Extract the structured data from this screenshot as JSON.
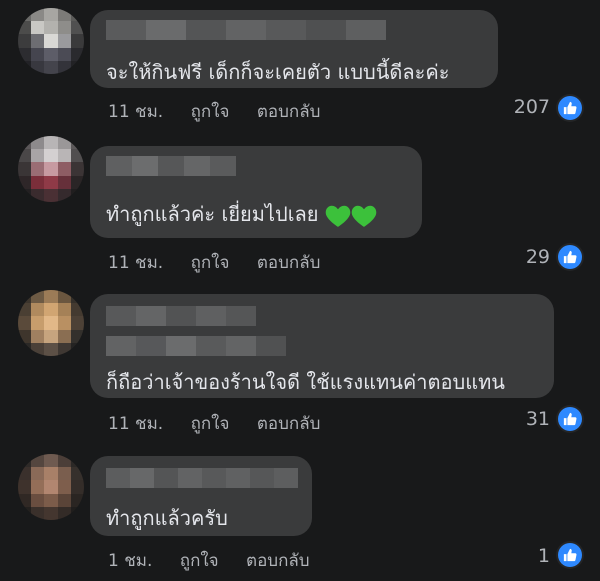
{
  "comments": [
    {
      "text": "จะให้กินฟรี เด็กก็จะเคยตัว แบบนี้ดีละค่ะ",
      "time": "11 ชม.",
      "like": "ถูกใจ",
      "reply": "ตอบกลับ",
      "reactions": "207"
    },
    {
      "text": "ทำถูกแล้วค่ะ เยี่ยมไปเลย",
      "emoji": "green-heart-icon",
      "time": "11 ชม.",
      "like": "ถูกใจ",
      "reply": "ตอบกลับ",
      "reactions": "29"
    },
    {
      "text": "ก็ถือว่าเจ้าของร้านใจดี ใช้แรงแทนค่าตอบแทน",
      "time": "11 ชม.",
      "like": "ถูกใจ",
      "reply": "ตอบกลับ",
      "reactions": "31"
    },
    {
      "text": "ทำถูกแล้วครับ",
      "time": "1 ชม.",
      "like": "ถูกใจ",
      "reply": "ตอบกลับ",
      "reactions": "1"
    }
  ],
  "colors": {
    "background": "#18191a",
    "bubble": "#3a3b3c",
    "like_badge": "#2e89ff",
    "heart": "#3cc13b"
  }
}
